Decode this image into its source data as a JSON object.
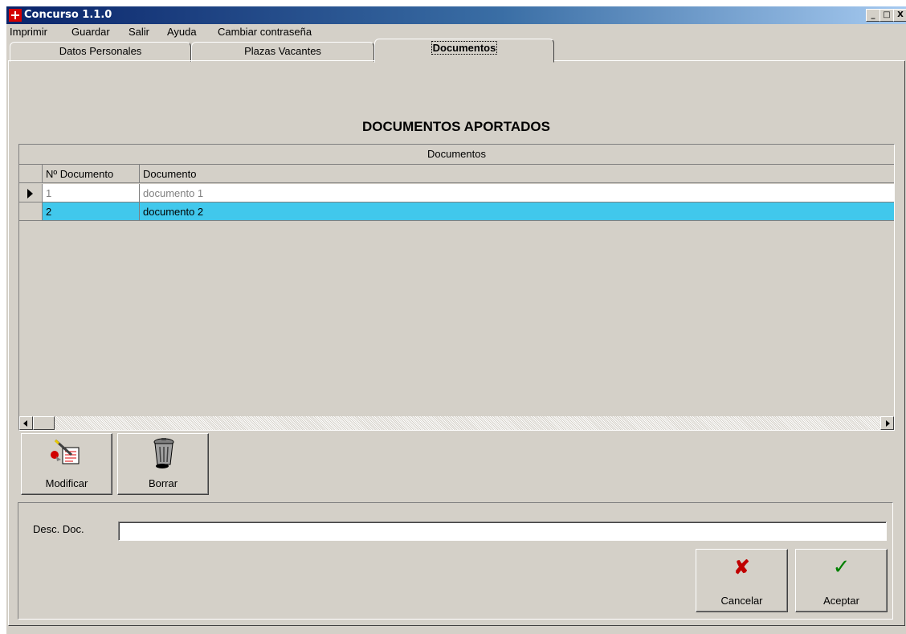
{
  "window": {
    "title": "Concurso 1.1.0",
    "controls": {
      "minimize": "_",
      "restore": "□",
      "close": "X"
    }
  },
  "menu": [
    "Imprimir",
    "Guardar",
    "Salir",
    "Ayuda",
    "Cambiar contraseña"
  ],
  "tabs": [
    {
      "label": "Datos Personales",
      "active": false
    },
    {
      "label": "Plazas Vacantes",
      "active": false
    },
    {
      "label": "Documentos",
      "active": true
    }
  ],
  "heading": "DOCUMENTOS APORTADOS",
  "grid": {
    "title": "Documentos",
    "columns": [
      "Nº Documento",
      "Documento"
    ],
    "rows": [
      {
        "num": "1",
        "doc": "documento 1",
        "current": true,
        "selected": false
      },
      {
        "num": "2",
        "doc": "documento 2",
        "current": false,
        "selected": true
      }
    ]
  },
  "toolbar": {
    "modify_label": "Modificar",
    "delete_label": "Borrar",
    "modify_icon": "edit-document-icon",
    "delete_icon": "trash-can-icon"
  },
  "form": {
    "desc_label": "Desc. Doc.",
    "desc_value": ""
  },
  "actions": {
    "cancel_label": "Cancelar",
    "accept_label": "Aceptar",
    "cancel_glyph": "✘",
    "accept_glyph": "✓"
  },
  "colors": {
    "title_gradient_start": "#0a246a",
    "selected_row": "#41c8ec",
    "face": "#d4d0c8",
    "cancel_icon": "#c00000",
    "accept_icon": "#008000"
  }
}
